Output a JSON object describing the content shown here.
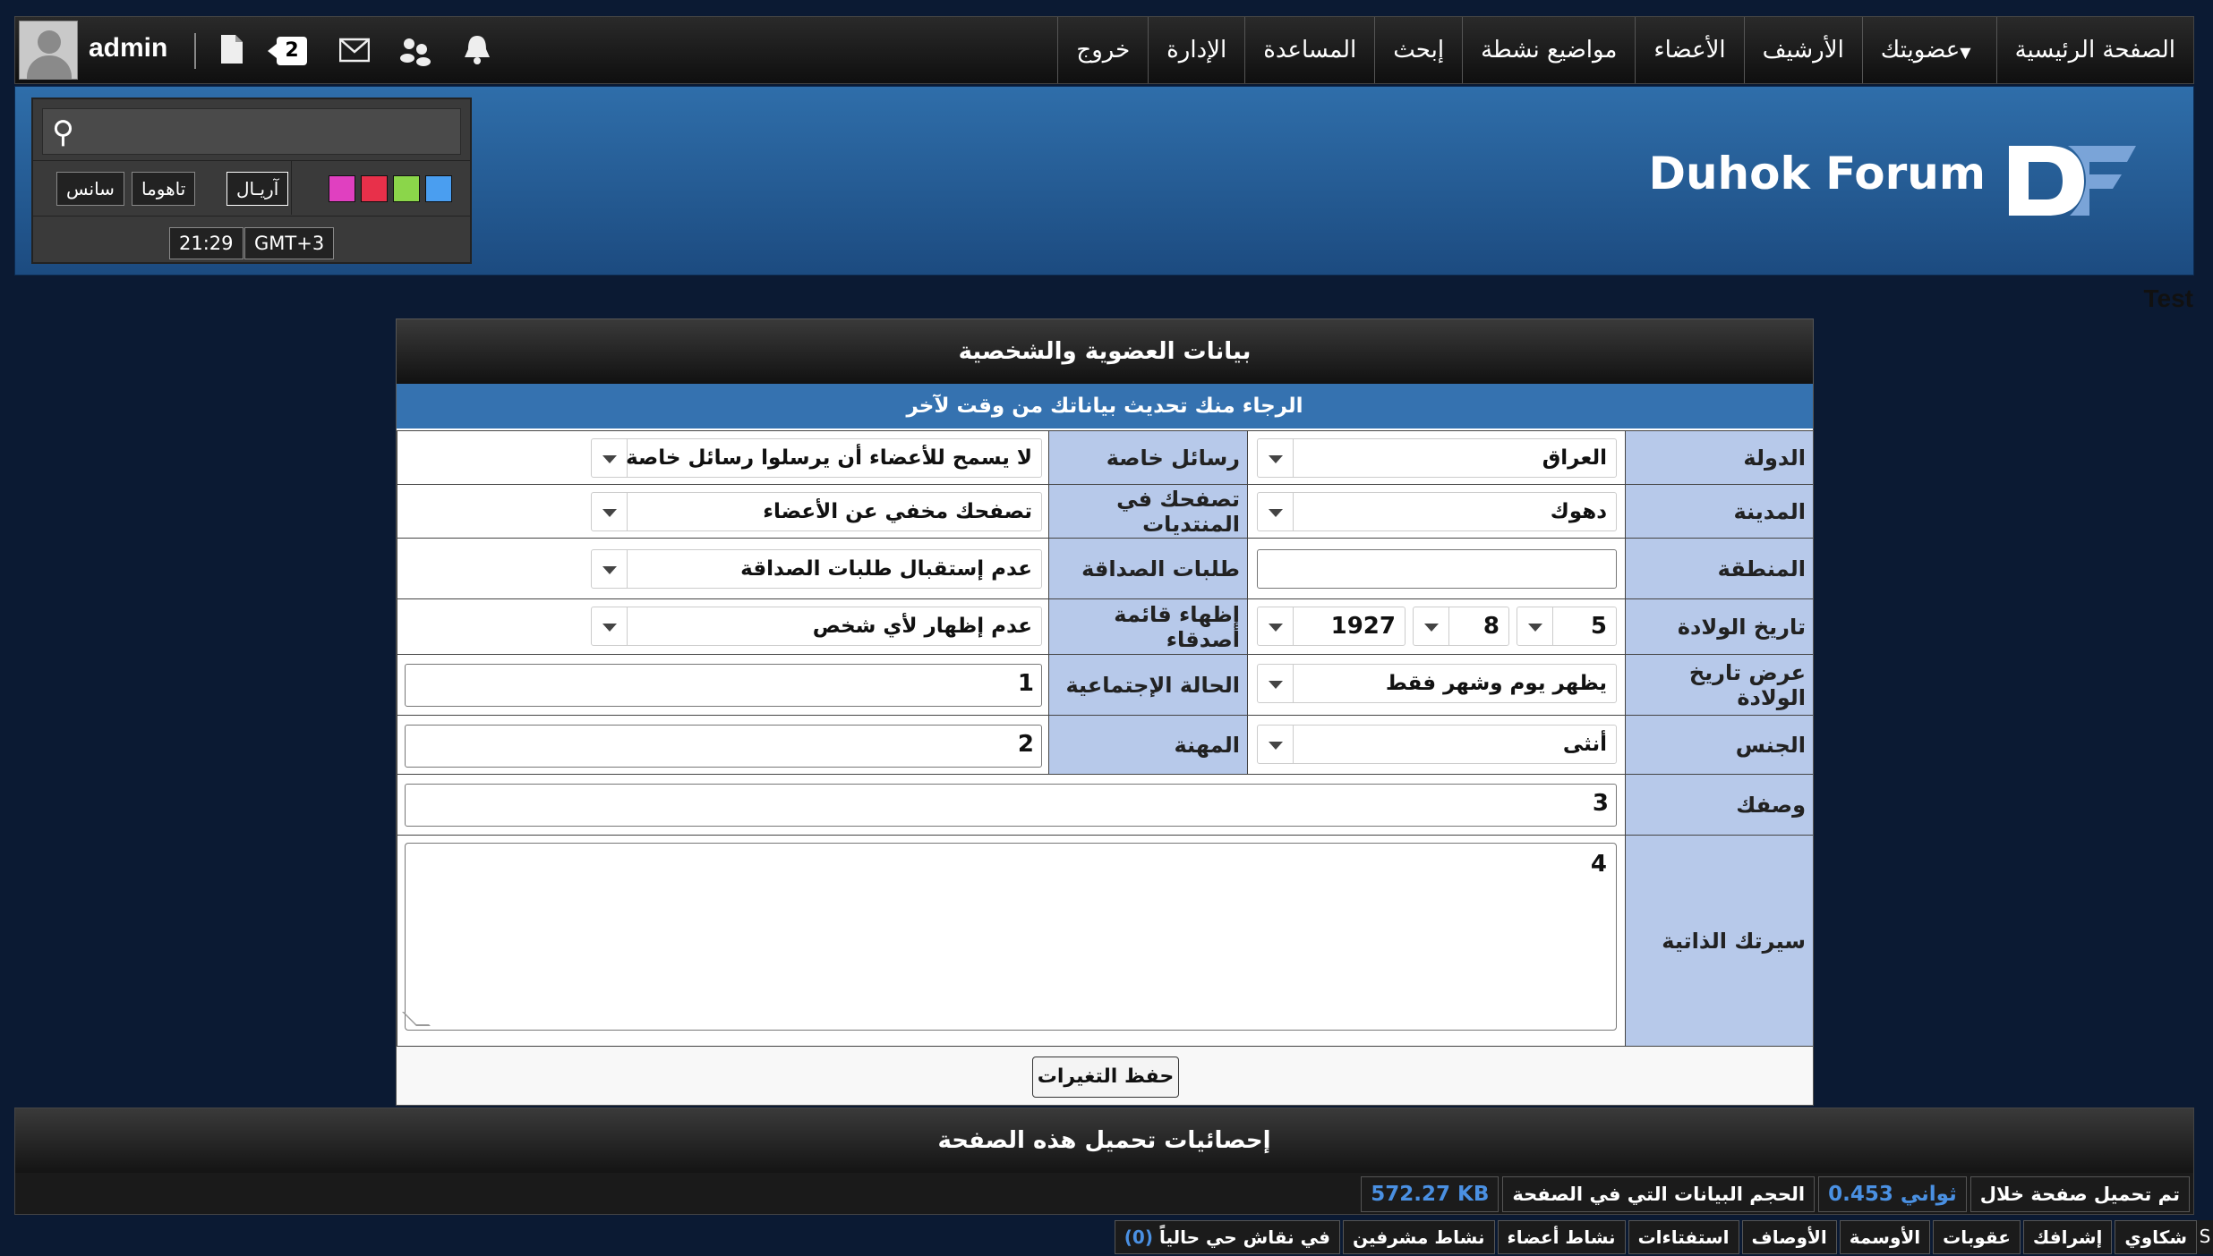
{
  "topbar": {
    "username": "admin",
    "notification_count": "2",
    "nav": [
      {
        "label": "الصفحة الرئيسية"
      },
      {
        "label": "عضويتك",
        "dropdown": true
      },
      {
        "label": "الأرشيف"
      },
      {
        "label": "الأعضاء"
      },
      {
        "label": "مواضيع نشطة"
      },
      {
        "label": "إبحث"
      },
      {
        "label": "المساعدة"
      },
      {
        "label": "الإدارة"
      },
      {
        "label": "خروج"
      }
    ]
  },
  "toolbox": {
    "fonts": [
      "آريـال",
      "تاهوما",
      "سانس"
    ],
    "swatches": [
      "#4a9ef0",
      "#8bd64a",
      "#e8304a",
      "#e040c0"
    ],
    "time": "21:29",
    "timezone": "GMT+3"
  },
  "logo": {
    "text": "Duhok Forum",
    "mark_color": "#ffffff",
    "mark_accent": "#7aa4d8"
  },
  "header_note": "Test",
  "form": {
    "title": "بيانات العضوية والشخصية",
    "subtitle": "الرجاء منك تحديث بياناتك من وقت لآخر",
    "country_label": "الدولة",
    "country_value": "العراق",
    "pm_label": "رسائل خاصة",
    "pm_value": "لا يسمح للأعضاء أن يرسلوا رسائل خاصة",
    "city_label": "المدينة",
    "city_value": "دهوك",
    "browse_label": "تصفحك في المنتديات",
    "browse_value": "تصفحك مخفي عن الأعضاء",
    "region_label": "المنطقة",
    "region_value": "",
    "friend_req_label": "طلبات الصداقة",
    "friend_req_value": "عدم إستقبال طلبات الصداقة",
    "birth_label": "تاريخ الولادة",
    "birth_day": "5",
    "birth_month": "8",
    "birth_year": "1927",
    "friends_list_label": "إظهاء قائمة أصدقاء",
    "friends_list_value": "عدم إظهار لأي شخص",
    "birth_display_label": "عرض تاريخ الولادة",
    "birth_display_value": "يظهر يوم وشهر فقط",
    "marital_label": "الحالة الإجتماعية",
    "marital_value": "1",
    "gender_label": "الجنس",
    "gender_value": "أنثى",
    "job_label": "المهنة",
    "job_value": "2",
    "desc_label": "وصفك",
    "desc_value": "3",
    "bio_label": "سيرتك الذاتية",
    "bio_value": "4",
    "save_label": "حفظ التغيرات"
  },
  "stats": {
    "title": "إحصائيات تحميل هذه الصفحة",
    "load_label": "تم تحميل صفحة خلال",
    "load_value": "0.453 ثواني",
    "size_label": "الحجم البيانات التي في الصفحة",
    "size_value": "572.27 KB"
  },
  "bottom": {
    "edge": "S",
    "items": [
      "شكاوي",
      "إشرافك",
      "عقوبات",
      "الأوسمة",
      "الأوصاف",
      "استفتاءات",
      "نشاط أعضاء",
      "نشاط مشرفين"
    ],
    "live_label": "في نقاش حي حالياً",
    "live_count": "(0)"
  }
}
